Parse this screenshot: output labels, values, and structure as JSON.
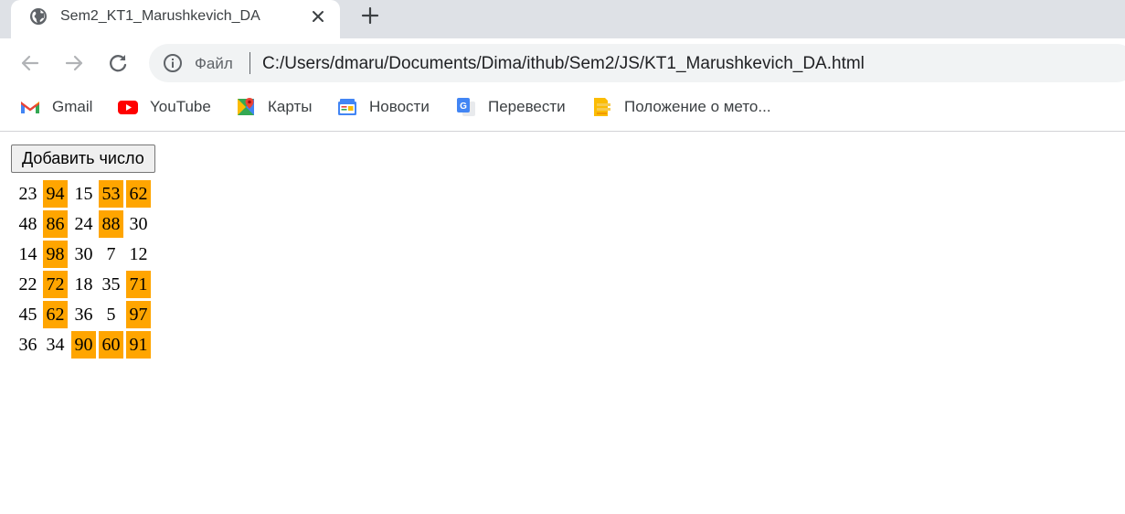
{
  "tab": {
    "title": "Sem2_KT1_Marushkevich_DA"
  },
  "toolbar": {
    "scheme_label": "Файл",
    "url": "C:/Users/dmaru/Documents/Dima/ithub/Sem2/JS/KT1_Marushkevich_DA.html"
  },
  "bookmarks": [
    {
      "label": "Gmail",
      "icon": "gmail-icon"
    },
    {
      "label": "YouTube",
      "icon": "youtube-icon"
    },
    {
      "label": "Карты",
      "icon": "maps-icon"
    },
    {
      "label": "Новости",
      "icon": "news-icon"
    },
    {
      "label": "Перевести",
      "icon": "translate-icon"
    },
    {
      "label": "Положение о мето...",
      "icon": "document-icon"
    }
  ],
  "page": {
    "add_button_label": "Добавить число",
    "highlight_color": "#ffa500",
    "rows": [
      [
        {
          "v": "23",
          "hl": false
        },
        {
          "v": "94",
          "hl": true
        },
        {
          "v": "15",
          "hl": false
        },
        {
          "v": "53",
          "hl": true
        },
        {
          "v": "62",
          "hl": true
        }
      ],
      [
        {
          "v": "48",
          "hl": false
        },
        {
          "v": "86",
          "hl": true
        },
        {
          "v": "24",
          "hl": false
        },
        {
          "v": "88",
          "hl": true
        },
        {
          "v": "30",
          "hl": false
        }
      ],
      [
        {
          "v": "14",
          "hl": false
        },
        {
          "v": "98",
          "hl": true
        },
        {
          "v": "30",
          "hl": false
        },
        {
          "v": "7",
          "hl": false
        },
        {
          "v": "12",
          "hl": false
        }
      ],
      [
        {
          "v": "22",
          "hl": false
        },
        {
          "v": "72",
          "hl": true
        },
        {
          "v": "18",
          "hl": false
        },
        {
          "v": "35",
          "hl": false
        },
        {
          "v": "71",
          "hl": true
        }
      ],
      [
        {
          "v": "45",
          "hl": false
        },
        {
          "v": "62",
          "hl": true
        },
        {
          "v": "36",
          "hl": false
        },
        {
          "v": "5",
          "hl": false
        },
        {
          "v": "97",
          "hl": true
        }
      ],
      [
        {
          "v": "36",
          "hl": false
        },
        {
          "v": "34",
          "hl": false
        },
        {
          "v": "90",
          "hl": true
        },
        {
          "v": "60",
          "hl": true
        },
        {
          "v": "91",
          "hl": true
        }
      ]
    ]
  }
}
